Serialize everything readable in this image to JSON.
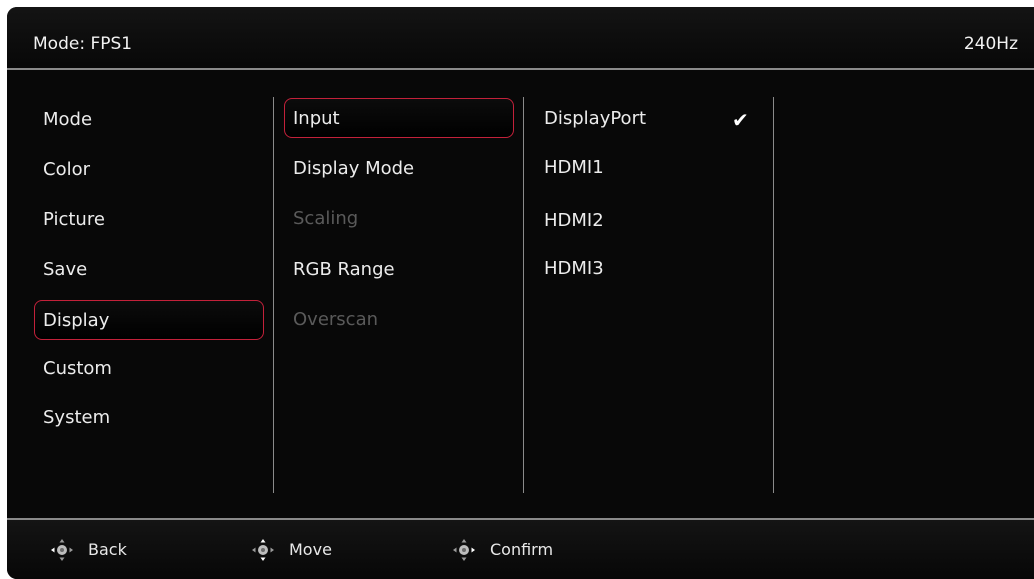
{
  "header": {
    "mode_label": "Mode: FPS1",
    "refresh_rate": "240Hz"
  },
  "menu": {
    "level1": [
      {
        "label": "Mode",
        "selected": false
      },
      {
        "label": "Color",
        "selected": false
      },
      {
        "label": "Picture",
        "selected": false
      },
      {
        "label": "Save",
        "selected": false
      },
      {
        "label": "Display",
        "selected": true
      },
      {
        "label": "Custom",
        "selected": false
      },
      {
        "label": "System",
        "selected": false
      }
    ],
    "level2": [
      {
        "label": "Input",
        "selected": true,
        "enabled": true
      },
      {
        "label": "Display Mode",
        "selected": false,
        "enabled": true
      },
      {
        "label": "Scaling",
        "selected": false,
        "enabled": false
      },
      {
        "label": "RGB Range",
        "selected": false,
        "enabled": true
      },
      {
        "label": "Overscan",
        "selected": false,
        "enabled": false
      }
    ],
    "level3": [
      {
        "label": "DisplayPort",
        "checked": true
      },
      {
        "label": "HDMI1",
        "checked": false
      },
      {
        "label": "HDMI2",
        "checked": false
      },
      {
        "label": "HDMI3",
        "checked": false
      }
    ]
  },
  "footer": {
    "back_label": "Back",
    "move_label": "Move",
    "confirm_label": "Confirm"
  },
  "colors": {
    "highlight": "#c3213a",
    "background": "#080808",
    "divider": "#8a8a8a",
    "disabled_text": "#5a5a5a"
  },
  "icons": {
    "checkmark": "check-icon",
    "joystick": "joystick-icon"
  }
}
